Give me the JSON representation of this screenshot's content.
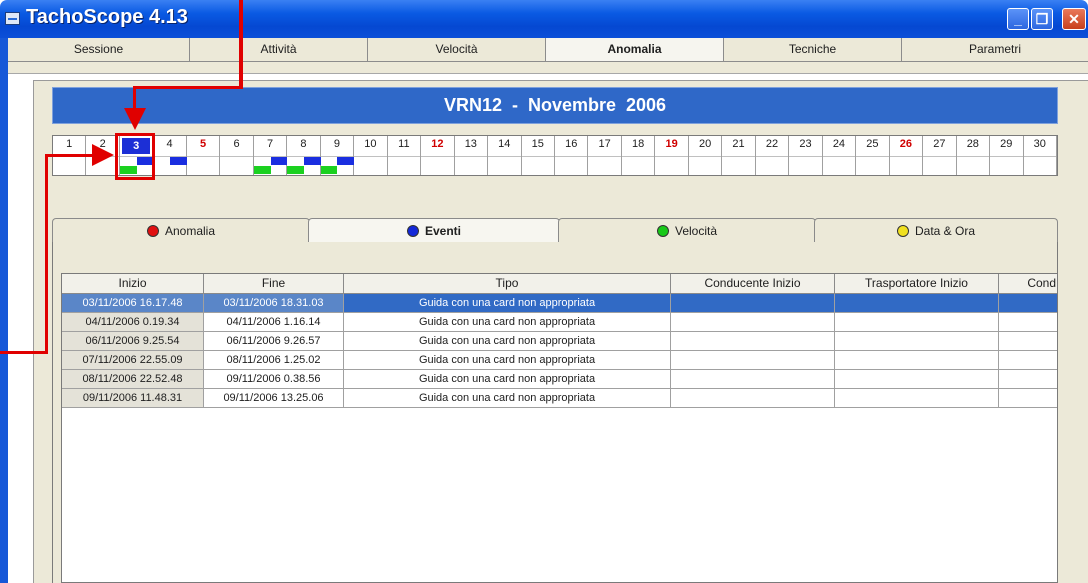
{
  "window": {
    "title": "TachoScope 4.13",
    "minimize": "_",
    "maximize": "❐",
    "close": "✕"
  },
  "main_tabs": [
    {
      "label": "Sessione",
      "active": false
    },
    {
      "label": "Attività",
      "active": false
    },
    {
      "label": "Velocità",
      "active": false
    },
    {
      "label": "Anomalia",
      "active": true
    },
    {
      "label": "Tecniche",
      "active": false
    },
    {
      "label": "Parametri",
      "active": false
    }
  ],
  "header": {
    "title": "VRN12  -  Novembre  2006"
  },
  "calendar": {
    "days": [
      "1",
      "2",
      "3",
      "4",
      "5",
      "6",
      "7",
      "8",
      "9",
      "10",
      "11",
      "12",
      "13",
      "14",
      "15",
      "16",
      "17",
      "18",
      "19",
      "20",
      "21",
      "22",
      "23",
      "24",
      "25",
      "26",
      "27",
      "28",
      "29",
      "30"
    ],
    "highlighted_red": [
      "5",
      "12",
      "19",
      "26"
    ],
    "selected_day": "3"
  },
  "sub_tabs": [
    {
      "label": "Anomalia",
      "dot_color": "#e01010",
      "active": false
    },
    {
      "label": "Eventi",
      "dot_color": "#1428d8",
      "active": true
    },
    {
      "label": "Velocità",
      "dot_color": "#18c818",
      "active": false
    },
    {
      "label": "Data & Ora",
      "dot_color": "#f0e020",
      "active": false
    }
  ],
  "table": {
    "columns": [
      "Inizio",
      "Fine",
      "Tipo",
      "Conducente Inizio",
      "Trasportatore Inizio",
      "Cond"
    ],
    "rows": [
      [
        "03/11/2006 16.17.48",
        "03/11/2006 18.31.03",
        "Guida con una card non appropriata",
        "",
        "",
        ""
      ],
      [
        "04/11/2006 0.19.34",
        "04/11/2006 1.16.14",
        "Guida con una card non appropriata",
        "",
        "",
        ""
      ],
      [
        "06/11/2006 9.25.54",
        "06/11/2006 9.26.57",
        "Guida con una card non appropriata",
        "",
        "",
        ""
      ],
      [
        "07/11/2006 22.55.09",
        "08/11/2006 1.25.02",
        "Guida con una card non appropriata",
        "",
        "",
        ""
      ],
      [
        "08/11/2006 22.52.48",
        "09/11/2006 0.38.56",
        "Guida con una card non appropriata",
        "",
        "",
        ""
      ],
      [
        "09/11/2006 11.48.31",
        "09/11/2006 13.25.06",
        "Guida con una card non appropriata",
        "",
        "",
        ""
      ]
    ],
    "selected_row": 0
  },
  "colors": {
    "accent": "#2f68c8",
    "selection": "#316ac5",
    "annotation": "#e00000"
  }
}
